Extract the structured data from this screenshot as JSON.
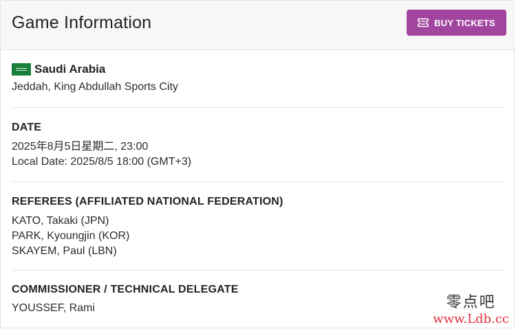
{
  "header": {
    "title": "Game Information",
    "buy_tickets_label": "BUY TICKETS",
    "button_color": "#a2459f"
  },
  "venue": {
    "flag_icon": "saudi-arabia-flag-icon",
    "country": "Saudi Arabia",
    "location": "Jeddah, King Abdullah Sports City"
  },
  "date": {
    "heading": "DATE",
    "datetime": "2025年8月5日星期二, 23:00",
    "local": "Local Date: 2025/8/5 18:00 (GMT+3)"
  },
  "referees": {
    "heading": "REFEREES (AFFILIATED NATIONAL FEDERATION)",
    "items": [
      "KATO, Takaki (JPN)",
      "PARK, Kyoungjin (KOR)",
      "SKAYEM, Paul (LBN)"
    ]
  },
  "commissioner": {
    "heading": "COMMISSIONER / TECHNICAL DELEGATE",
    "name": "YOUSSEF, Rami"
  },
  "watermark": {
    "text_cn": "零点吧",
    "url": "www.Ldb.cc"
  }
}
